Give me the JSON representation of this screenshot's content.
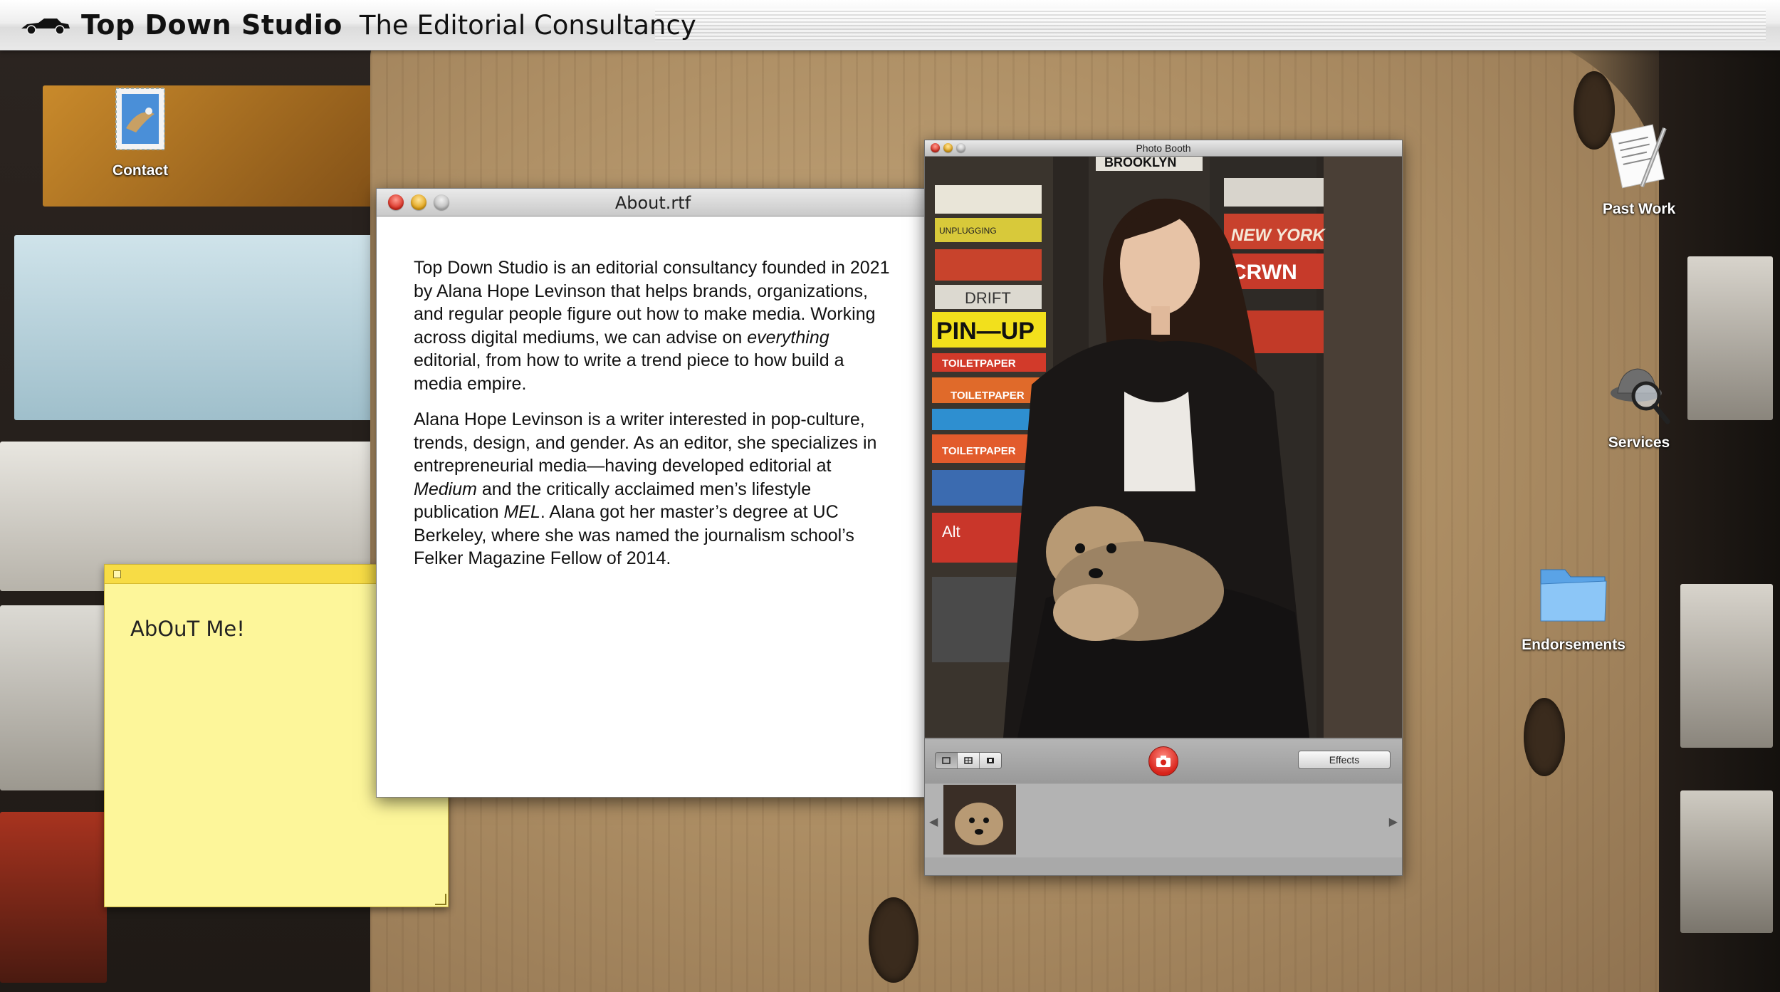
{
  "menubar": {
    "brand": "Top Down Studio",
    "tagline": "The Editorial Consultancy",
    "logo_icon": "car-icon"
  },
  "desktop_icons": [
    {
      "label": "Contact",
      "icon": "mail-stamp-icon"
    },
    {
      "label": "Past Work",
      "icon": "document-pen-icon"
    },
    {
      "label": "Services",
      "icon": "detective-magnifier-icon"
    },
    {
      "label": "Endorsements",
      "icon": "folder-icon"
    }
  ],
  "sticky_note": {
    "text": "AbOuT Me!"
  },
  "about_window": {
    "title": "About.rtf",
    "paragraph1": {
      "part1": "Top Down Studio is an editorial consultancy founded in 2021 by Alana Hope Levinson that helps brands, organizations, and regular people figure out how to make media. Working across digital mediums, we can advise on ",
      "em1": "everything",
      "part2": " editorial, from how to write a trend piece to how build a media empire."
    },
    "paragraph2": {
      "part1": "Alana Hope Levinson is a writer interested in pop-culture, trends, design, and gender. As an editor, she specializes in entrepreneurial media—having developed editorial at ",
      "em1": "Medium",
      "part2": " and the critically acclaimed men’s lifestyle publication ",
      "em2": "MEL",
      "part3": ". Alana got her master’s degree at UC Berkeley, where she was named the journalism school’s Felker Magazine Fellow of 2014."
    }
  },
  "photo_booth": {
    "title": "Photo Booth",
    "effects_label": "Effects",
    "magazine_labels": [
      "BROOKLYN",
      "NEW YORK",
      "CRWN",
      "DRIFT",
      "PIN—UP",
      "TOILETPAPER",
      "TOILETPAPER",
      "TOILETPAPER",
      "UNPLUGGING",
      "Alt"
    ],
    "accent": "#d8231a"
  }
}
